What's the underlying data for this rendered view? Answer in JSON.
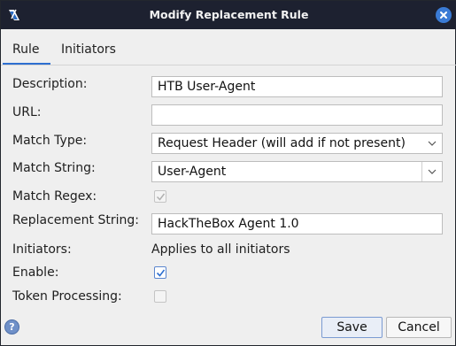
{
  "window": {
    "title": "Modify Replacement Rule"
  },
  "tabs": [
    {
      "label": "Rule",
      "selected": true
    },
    {
      "label": "Initiators",
      "selected": false
    }
  ],
  "form": {
    "description": {
      "label": "Description:",
      "value": "HTB User-Agent"
    },
    "url": {
      "label": "URL:",
      "value": ""
    },
    "match_type": {
      "label": "Match Type:",
      "selected": "Request Header (will add if not present)"
    },
    "match_string": {
      "label": "Match String:",
      "value": "User-Agent"
    },
    "match_regex": {
      "label": "Match Regex:",
      "checked": true,
      "enabled": false
    },
    "replacement_string": {
      "label": "Replacement String:",
      "value": "HackTheBox Agent 1.0"
    },
    "initiators": {
      "label": "Initiators:",
      "value": "Applies to all initiators"
    },
    "enable": {
      "label": "Enable:",
      "checked": true,
      "enabled": true
    },
    "token_processing": {
      "label": "Token Processing:",
      "checked": false,
      "enabled": false
    }
  },
  "footer": {
    "help_icon": "question-mark",
    "save_label": "Save",
    "cancel_label": "Cancel"
  },
  "colors": {
    "titlebar": "#1d2130",
    "accent": "#2e6fd0",
    "background": "#efefef"
  }
}
